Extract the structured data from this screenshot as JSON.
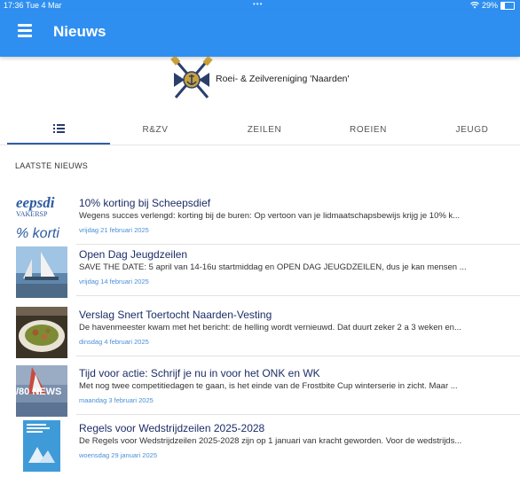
{
  "status_bar": {
    "time": "17:36  Tue 4 Mar",
    "dots": "•••",
    "wifi_icon": "wifi-icon",
    "battery": "29%",
    "battery_level": 0.29
  },
  "app_bar": {
    "menu_icon": "hamburger-menu-icon",
    "title": "Nieuws",
    "color": "#2f8ff0"
  },
  "logo": {
    "club_name": "Roei- & Zeilvereniging 'Naarden'"
  },
  "tabs": [
    {
      "label": "",
      "icon": "list-icon",
      "active": true
    },
    {
      "label": "R&ZV"
    },
    {
      "label": "ZEILEN"
    },
    {
      "label": "ROEIEN"
    },
    {
      "label": "JEUGD"
    }
  ],
  "section_title": "LAATSTE NIEUWS",
  "news": [
    {
      "title": "10% korting bij Scheepsdief",
      "snippet": "Wegens succes verlengd: korting bij de buren: Op vertoon van je lidmaatschapsbewijs krijg je 10% k...",
      "date": "vrijdag 21 februari 2025",
      "thumb_text_1": "eepsdi",
      "thumb_text_2": "% korti"
    },
    {
      "title": "Open Dag Jeugdzeilen",
      "snippet": "SAVE THE DATE: 5 april van 14-16u startmiddag en OPEN DAG JEUGDZEILEN, dus je kan mensen ...",
      "date": "vrijdag 14 februari 2025"
    },
    {
      "title": "Verslag Snert Toertocht Naarden-Vesting",
      "snippet": "De havenmeester kwam met het bericht: de helling wordt vernieuwd. Dat duurt zeker 2 a 3 weken en...",
      "date": "dinsdag 4 februari 2025"
    },
    {
      "title": "Tijd voor actie: Schrijf je nu in voor het ONK en WK",
      "snippet": "Met nog twee competitiedagen te gaan, is het einde van de Frostbite Cup winterserie in zicht. Maar ...",
      "date": "maandag 3 februari 2025",
      "thumb_text_1": "/80 NEWS"
    },
    {
      "title": "Regels voor Wedstrijdzeilen 2025-2028",
      "snippet": "De Regels voor Wedstrijdzeilen 2025-2028 zijn op 1 januari van kracht geworden. Voor de wedstrijds...",
      "date": "woensdag 29 januari 2025"
    }
  ]
}
